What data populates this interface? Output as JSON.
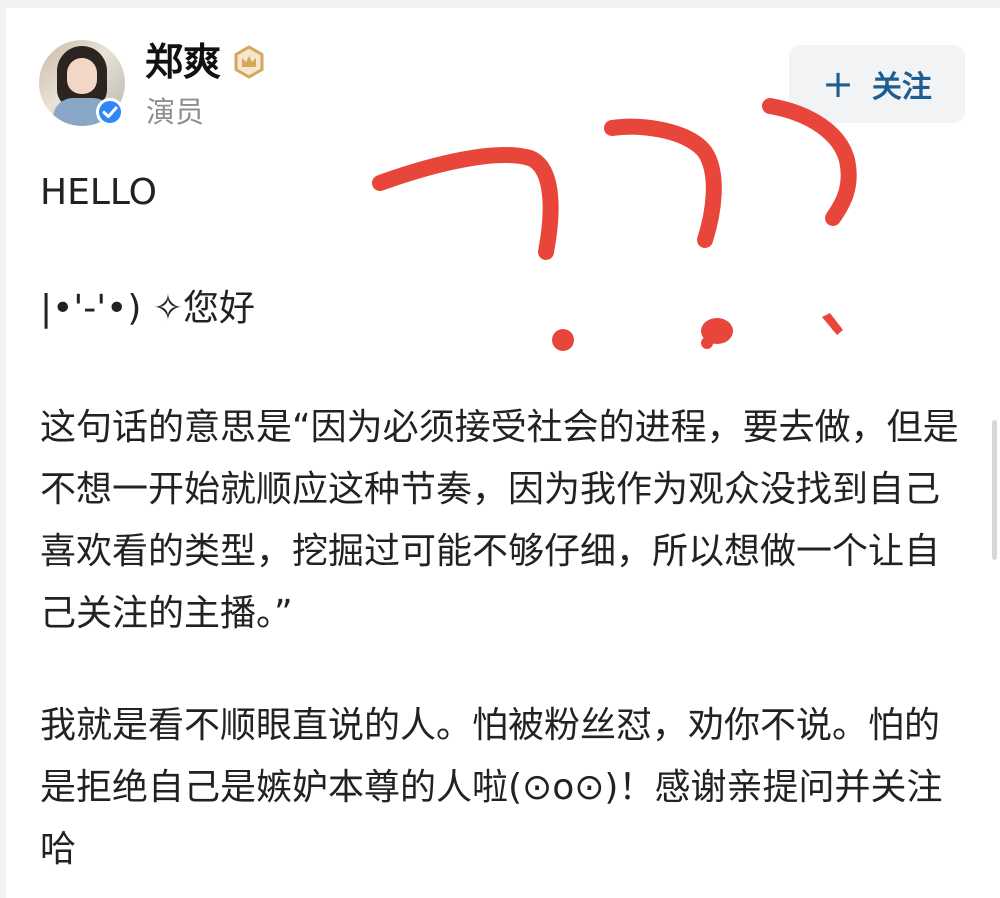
{
  "user": {
    "name": "郑爽",
    "role": "演员"
  },
  "follow_button": {
    "icon": "plus-icon",
    "label": "关注"
  },
  "post": {
    "paragraphs": [
      "HELLO",
      "|•'-'•) ✧您好",
      "这句话的意思是“因为必须接受社会的进程，要去做，但是不想一开始就顺应这种节奏，因为我作为观众没找到自己喜欢看的类型，挖掘过可能不够仔细，所以想做一个让自己关注的主播。”",
      "我就是看不顺眼直说的人。怕被粉丝怼，劝你不说。怕的是拒绝自己是嫉妒本尊的人啦(⊙o⊙)！感谢亲提问并关注哈"
    ]
  },
  "annotations": {
    "color": "#e8463a",
    "text": "???"
  },
  "colors": {
    "follow_text": "#1d5d8f",
    "verified_badge": "#2f86f6",
    "crown_badge": "#d4a85a"
  }
}
